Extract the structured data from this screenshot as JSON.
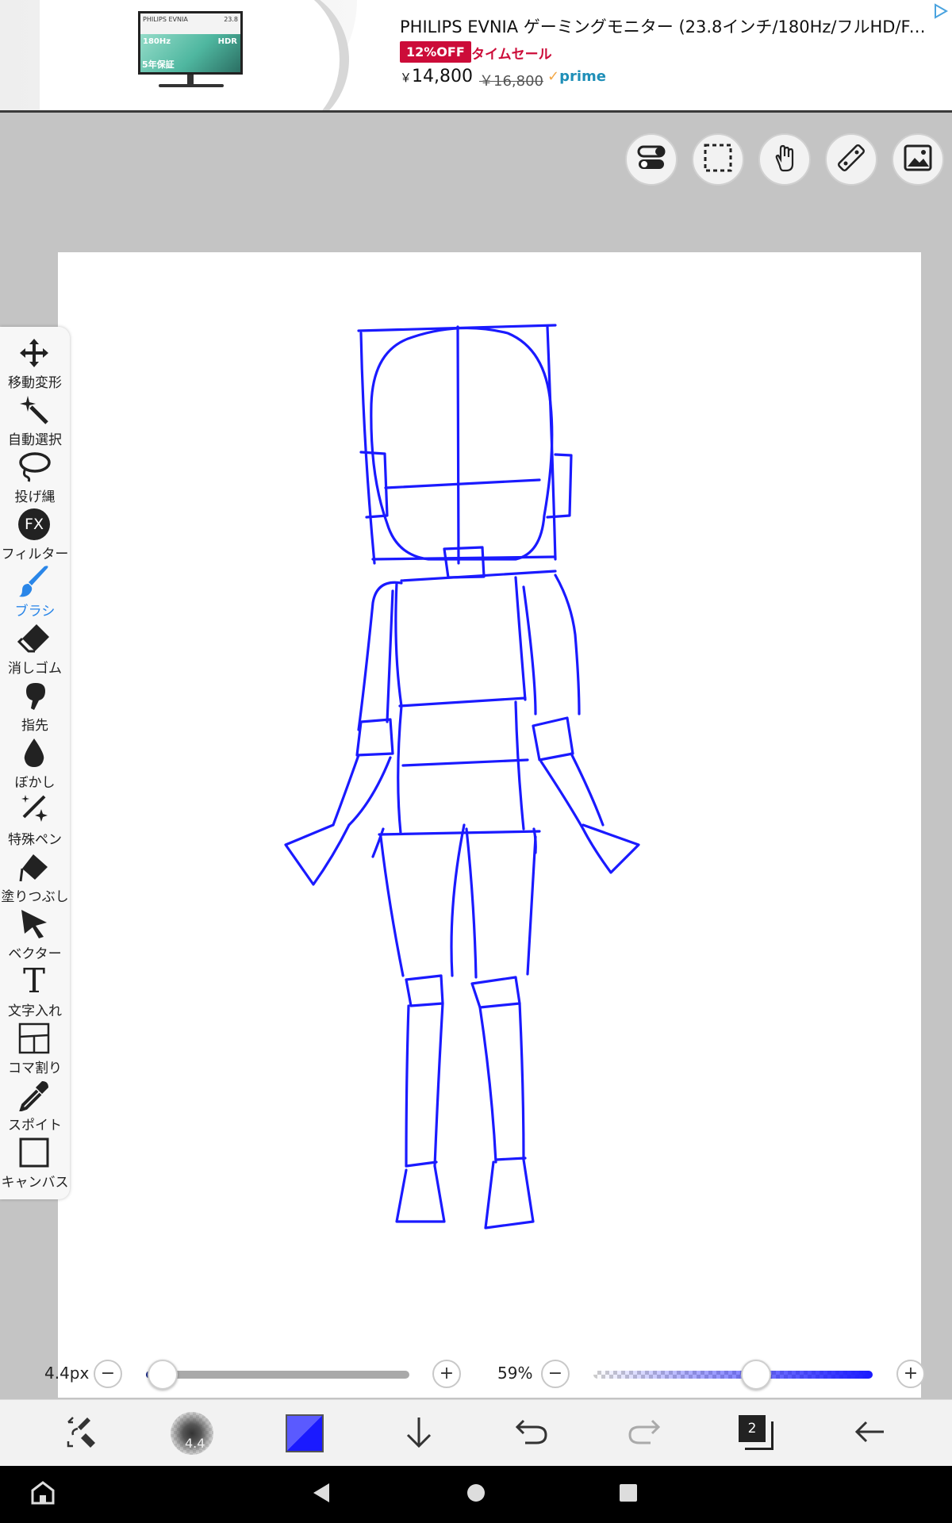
{
  "ad": {
    "title": "PHILIPS EVNIA ゲーミングモニター (23.8インチ/180Hz/フルHD/Fas...",
    "badge": "12%OFF",
    "sale_label": "タイムセール",
    "price_currency": "￥",
    "price": "14,800",
    "old_price": "￥16,800",
    "prime_label": "prime",
    "monitor_brand": "PHILIPS EVNIA",
    "monitor_size": "23.8",
    "monitor_hz": "180Hz",
    "monitor_hdr": "HDR",
    "monitor_warranty": "5年保証"
  },
  "tools": [
    {
      "label": "移動変形",
      "icon": "move-icon"
    },
    {
      "label": "自動選択",
      "icon": "magic-wand-icon"
    },
    {
      "label": "投げ縄",
      "icon": "lasso-icon"
    },
    {
      "label": "フィルター",
      "icon": "fx-icon",
      "glyph": "FX"
    },
    {
      "label": "ブラシ",
      "icon": "brush-icon"
    },
    {
      "label": "消しゴム",
      "icon": "eraser-icon"
    },
    {
      "label": "指先",
      "icon": "finger-icon"
    },
    {
      "label": "ぼかし",
      "icon": "blur-drop-icon"
    },
    {
      "label": "特殊ペン",
      "icon": "special-pen-icon"
    },
    {
      "label": "塗りつぶし",
      "icon": "fill-bucket-icon"
    },
    {
      "label": "ベクター",
      "icon": "vector-arrow-icon"
    },
    {
      "label": "文字入れ",
      "icon": "text-icon",
      "glyph": "T"
    },
    {
      "label": "コマ割り",
      "icon": "panel-split-icon"
    },
    {
      "label": "スポイト",
      "icon": "eyedropper-icon"
    },
    {
      "label": "キャンバス",
      "icon": "canvas-icon"
    }
  ],
  "active_tool": "ブラシ",
  "brush_size": {
    "label": "4.4px",
    "minus": "−",
    "plus": "+",
    "level": 0.02
  },
  "opacity": {
    "label": "59%",
    "minus": "−",
    "plus": "+",
    "level": 0.59
  },
  "bottom": {
    "brush_preview_value": "4.4",
    "layer_count": "2"
  },
  "colors": {
    "brush": "#1a1aff",
    "active": "#2a86e8",
    "canvas": "#ffffff",
    "background": "#c4c4c4"
  }
}
